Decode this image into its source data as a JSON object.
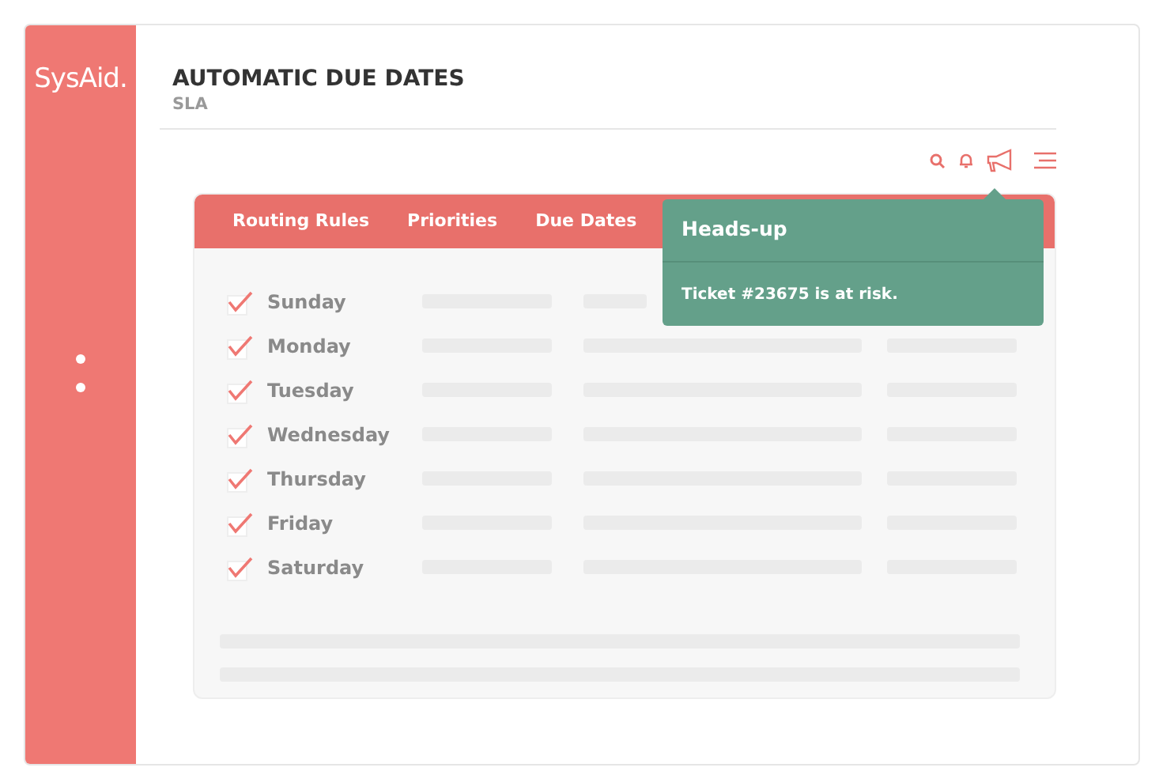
{
  "sidebar": {
    "logo": "SysAid."
  },
  "header": {
    "title": "AUTOMATIC DUE DATES",
    "subtitle": "SLA"
  },
  "tabs": [
    {
      "label": "Routing Rules",
      "selected": false
    },
    {
      "label": "Priorities",
      "selected": false
    },
    {
      "label": "Due Dates",
      "selected": false
    }
  ],
  "days": [
    {
      "name": "Sunday",
      "checked": true
    },
    {
      "name": "Monday",
      "checked": true
    },
    {
      "name": "Tuesday",
      "checked": true
    },
    {
      "name": "Wednesday",
      "checked": true
    },
    {
      "name": "Thursday",
      "checked": true
    },
    {
      "name": "Friday",
      "checked": true
    },
    {
      "name": "Saturday",
      "checked": true
    }
  ],
  "notification": {
    "title": "Heads-up",
    "message": "Ticket #23675 is at risk."
  }
}
